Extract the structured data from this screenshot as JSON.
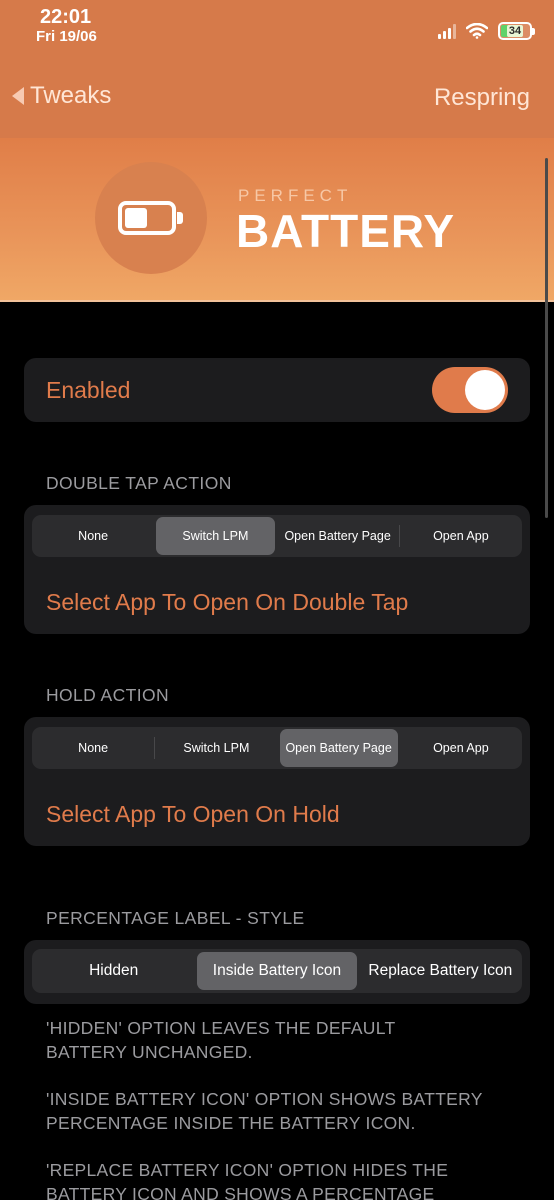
{
  "status": {
    "time": "22:01",
    "date": "Fri 19/06",
    "battery": "34"
  },
  "nav": {
    "back_label": "Tweaks",
    "action_label": "Respring"
  },
  "banner": {
    "subtitle": "PERFECT",
    "title": "BATTERY"
  },
  "enabled": {
    "label": "Enabled",
    "on": true
  },
  "double_tap": {
    "header": "DOUBLE TAP ACTION",
    "options": [
      "None",
      "Switch LPM",
      "Open Battery Page",
      "Open App"
    ],
    "selected": "Switch LPM",
    "link": "Select App To Open On Double Tap"
  },
  "hold": {
    "header": "HOLD ACTION",
    "options": [
      "None",
      "Switch LPM",
      "Open Battery Page",
      "Open App"
    ],
    "selected": "Open Battery Page",
    "link": "Select App To Open On Hold"
  },
  "percentage_style": {
    "header": "PERCENTAGE LABEL - STYLE",
    "options": [
      "Hidden",
      "Inside Battery Icon",
      "Replace Battery Icon"
    ],
    "selected": "Inside Battery Icon",
    "notes": [
      [
        "'HIDDEN' OPTION LEAVES THE DEFAULT",
        "BATTERY UNCHANGED."
      ],
      [
        "'INSIDE BATTERY ICON' OPTION SHOWS BATTERY",
        "PERCENTAGE INSIDE THE BATTERY ICON."
      ],
      [
        "'REPLACE BATTERY ICON' OPTION HIDES THE",
        "BATTERY ICON AND SHOWS A PERCENTAGE"
      ]
    ]
  },
  "colors": {
    "accent": "#e07b4b",
    "header_bg": "#d67a4a",
    "card_bg": "#1c1c1e"
  }
}
